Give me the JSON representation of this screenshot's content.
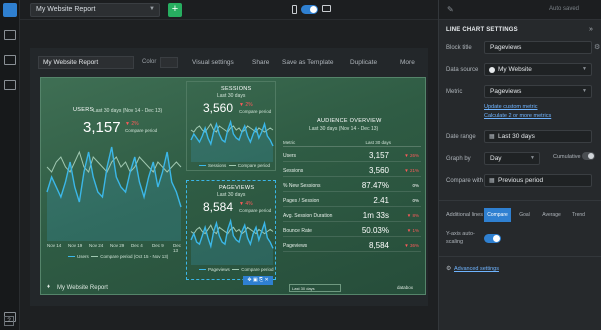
{
  "topbar": {
    "report_name": "My Website Report",
    "add_label": "+"
  },
  "subbar": {
    "name_value": "My Website Report",
    "color_label": "Color",
    "visual_settings": "Visual settings",
    "share": "Share",
    "save_template": "Save as Template",
    "duplicate": "Duplicate",
    "more": "More"
  },
  "dashboard": {
    "users": {
      "title": "USERS",
      "period": "Last 30 days (Nov 14 - Dec 13)",
      "value": "3,157",
      "delta": "▼ 2%",
      "compare": "Compare period",
      "xticks": [
        "Nov 14",
        "Nov 19",
        "Nov 24",
        "Nov 29",
        "Dec 4",
        "Dec 9",
        "Dec 13"
      ],
      "legend_current": "Users",
      "legend_compare": "Compare period (Oct 15 - Nov 13)",
      "series_current": [
        9,
        12,
        10,
        8,
        11,
        15,
        10,
        7,
        13,
        17,
        12,
        9,
        8,
        14,
        18,
        12,
        10,
        9,
        13,
        16,
        11,
        8,
        12,
        15,
        10,
        13,
        17,
        11,
        9,
        6
      ],
      "series_compare": [
        14,
        13,
        15,
        16,
        14,
        13,
        15,
        17,
        14,
        13,
        16,
        15,
        14,
        13,
        15,
        16,
        14,
        15,
        13,
        14,
        16,
        15,
        14,
        13,
        15,
        14,
        13,
        14,
        15,
        14
      ]
    },
    "sessions": {
      "title": "SESSIONS",
      "period": "Last 30 days",
      "value": "3,560",
      "delta": "▼ 2%",
      "compare": "Compare period",
      "legend_current": "Sessions",
      "legend_compare": "Compare period",
      "series_current": [
        9,
        12,
        10,
        8,
        11,
        15,
        10,
        7,
        13,
        17,
        12,
        9,
        8,
        14,
        18,
        12,
        10,
        9,
        13,
        16,
        11,
        8,
        12,
        15,
        10,
        13,
        17,
        11,
        9,
        6
      ],
      "series_compare": [
        14,
        13,
        15,
        16,
        14,
        13,
        15,
        17,
        14,
        13,
        16,
        15,
        14,
        13,
        15,
        16,
        14,
        15,
        13,
        14,
        16,
        15,
        14,
        13,
        15,
        14,
        13,
        14,
        15,
        14
      ]
    },
    "pageviews": {
      "title": "PAGEVIEWS",
      "period": "Last 30 days",
      "value": "8,584",
      "delta": "▼ 4%",
      "compare": "Compare period",
      "legend_current": "Pageviews",
      "legend_compare": "Compare period",
      "series_current": [
        10,
        13,
        9,
        8,
        12,
        16,
        11,
        7,
        14,
        18,
        12,
        9,
        8,
        15,
        19,
        12,
        10,
        9,
        14,
        17,
        11,
        8,
        13,
        16,
        10,
        14,
        18,
        11,
        9,
        6
      ],
      "series_compare": [
        14,
        13,
        15,
        16,
        14,
        13,
        15,
        17,
        14,
        13,
        16,
        15,
        14,
        13,
        15,
        16,
        14,
        15,
        13,
        14,
        16,
        15,
        14,
        13,
        15,
        14,
        13,
        14,
        15,
        14
      ]
    },
    "audience": {
      "title": "AUDIENCE OVERVIEW",
      "period": "Last 30 days (Nov 14 - Dec 13)",
      "col_metric": "Metric",
      "col_value": "Last 30 days",
      "rows": [
        {
          "metric": "Users",
          "value": "3,157",
          "delta": "▼ 26%"
        },
        {
          "metric": "Sessions",
          "value": "3,560",
          "delta": "▼ 21%"
        },
        {
          "metric": "% New Sessions",
          "value": "87.47%",
          "delta": "0%"
        },
        {
          "metric": "Pages / Session",
          "value": "2.41",
          "delta": "0%"
        },
        {
          "metric": "Avg. Session Duration",
          "value": "1m 33s",
          "delta": "▼ 8%"
        },
        {
          "metric": "Bounce Rate",
          "value": "50.03%",
          "delta": "▼ 1%"
        },
        {
          "metric": "Pageviews",
          "value": "8,584",
          "delta": "▼ 36%"
        }
      ]
    },
    "footer_name": "My Website Report",
    "footer_time": "Last 30 days",
    "footer_powered": "databox"
  },
  "right": {
    "autosaved": "Auto saved",
    "header": "LINE CHART SETTINGS",
    "close": "»",
    "block_title_label": "Block title",
    "block_title_value": "Pageviews",
    "data_source_label": "Data source",
    "data_source_value": "My Website",
    "metric_label": "Metric",
    "metric_value": "Pageviews",
    "link_custom": "Update custom metric",
    "link_combine": "Calculate 2 or more metrics",
    "date_range_label": "Date range",
    "date_range_value": "Last 30 days",
    "graph_by_label": "Graph by",
    "graph_by_value": "Day",
    "cumulative_label": "Cumulative",
    "compare_with_label": "Compare with",
    "compare_with_value": "Previous period",
    "additional_lines_label": "Additional lines",
    "tabs": [
      "Compare",
      "Goal",
      "Average",
      "Trend"
    ],
    "yaxis_label_1": "Y-axis auto-",
    "yaxis_label_2": "scaling",
    "advanced": "Advanced settings"
  }
}
